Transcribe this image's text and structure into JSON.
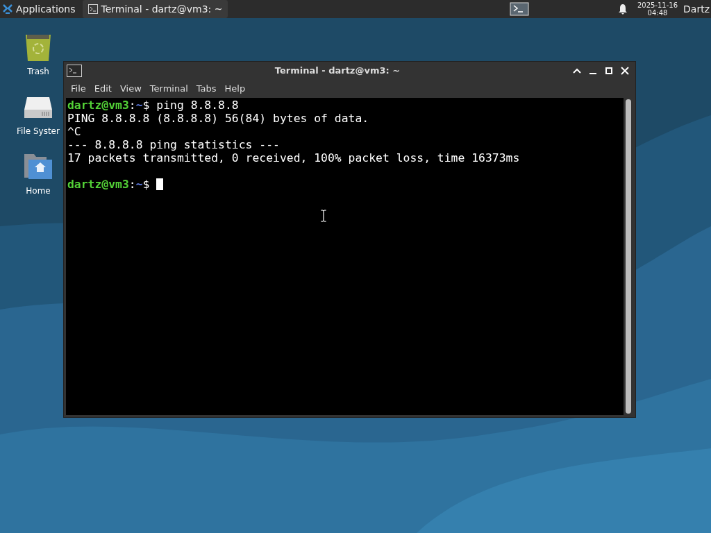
{
  "panel": {
    "menu_label": "Applications",
    "tasks": [
      {
        "title": "Terminal - dartz@vm3: ~",
        "selected": true
      }
    ],
    "date": "2025-11-16",
    "time": "04:48",
    "user": "Dartz"
  },
  "desktop_icons": [
    {
      "kind": "trash",
      "label": "Trash"
    },
    {
      "kind": "drive",
      "label": "File Syster"
    },
    {
      "kind": "home",
      "label": "Home"
    }
  ],
  "window": {
    "title": "Terminal - dartz@vm3: ~",
    "menu": [
      "File",
      "Edit",
      "View",
      "Terminal",
      "Tabs",
      "Help"
    ],
    "lines": [
      {
        "kind": "prompt",
        "user_host": "dartz@vm3",
        "separator": ":",
        "path": "~",
        "symbol": "$",
        "command": "ping 8.8.8.8",
        "cursor": false
      },
      {
        "kind": "output",
        "text": "PING 8.8.8.8 (8.8.8.8) 56(84) bytes of data."
      },
      {
        "kind": "output",
        "text": "^C"
      },
      {
        "kind": "output",
        "text": "--- 8.8.8.8 ping statistics ---"
      },
      {
        "kind": "output",
        "text": "17 packets transmitted, 0 received, 100% packet loss, time 16373ms"
      },
      {
        "kind": "blank"
      },
      {
        "kind": "prompt",
        "user_host": "dartz@vm3",
        "separator": ":",
        "path": "~",
        "symbol": "$",
        "cursor": true
      }
    ]
  }
}
